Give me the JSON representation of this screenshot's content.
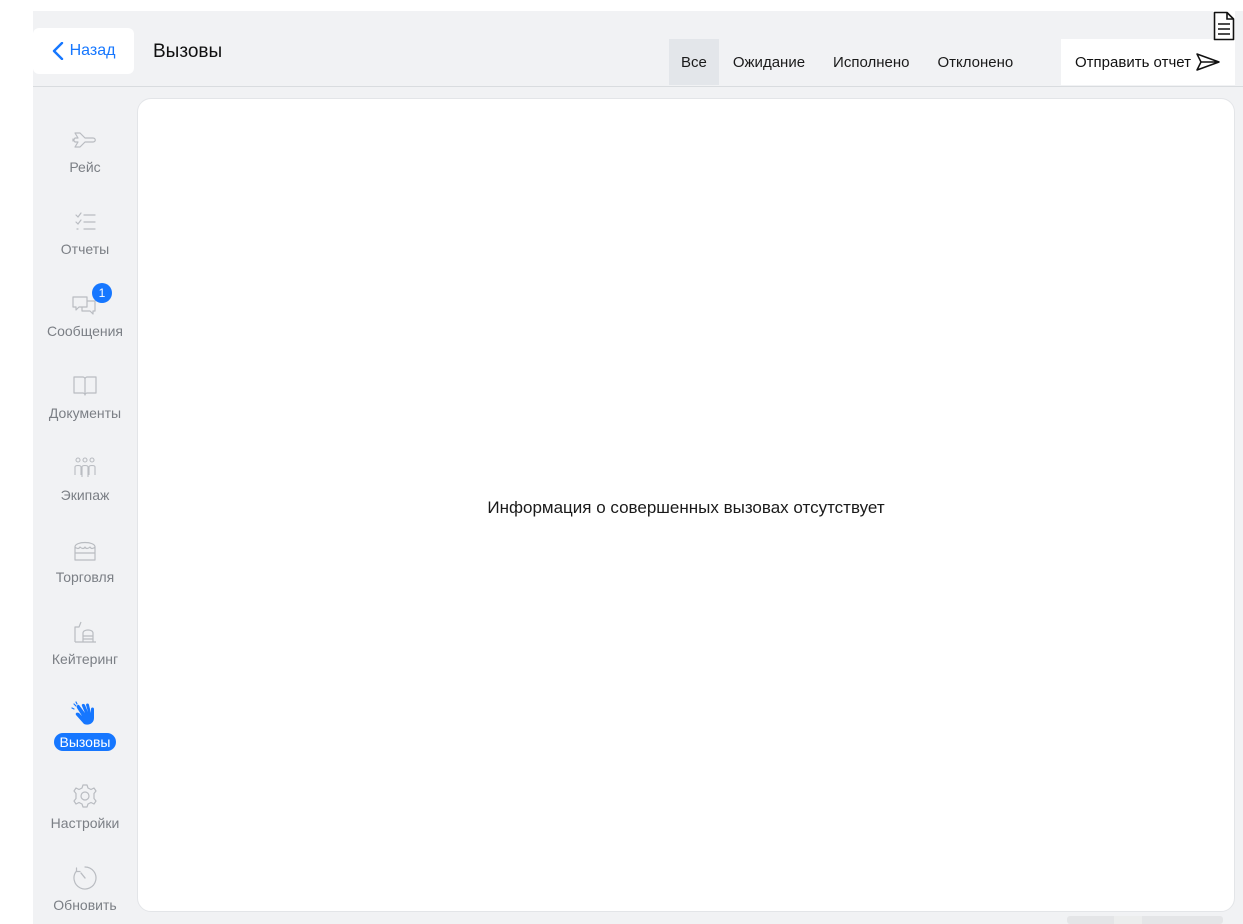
{
  "header": {
    "back_label": "Назад",
    "title": "Вызовы",
    "tabs": [
      {
        "label": "Все",
        "active": true
      },
      {
        "label": "Ожидание",
        "active": false
      },
      {
        "label": "Исполнено",
        "active": false
      },
      {
        "label": "Отклонено",
        "active": false
      }
    ],
    "send_report_label": "Отправить отчет"
  },
  "sidebar": {
    "items": [
      {
        "label": "Рейс",
        "icon": "plane-icon"
      },
      {
        "label": "Отчеты",
        "icon": "checklist-icon"
      },
      {
        "label": "Сообщения",
        "icon": "chat-icon",
        "badge": "1"
      },
      {
        "label": "Документы",
        "icon": "book-icon"
      },
      {
        "label": "Экипаж",
        "icon": "crew-icon"
      },
      {
        "label": "Торговля",
        "icon": "store-icon"
      },
      {
        "label": "Кейтеринг",
        "icon": "catering-icon"
      },
      {
        "label": "Вызовы",
        "icon": "waving-hand-icon",
        "active": true
      },
      {
        "label": "Настройки",
        "icon": "gear-icon"
      },
      {
        "label": "Обновить",
        "icon": "refresh-timer-icon"
      }
    ]
  },
  "main": {
    "empty_message": "Информация о совершенных вызовах отсутствует"
  },
  "colors": {
    "accent": "#1677ff",
    "background": "#f1f2f4",
    "inactive_text": "#7b7f85"
  }
}
